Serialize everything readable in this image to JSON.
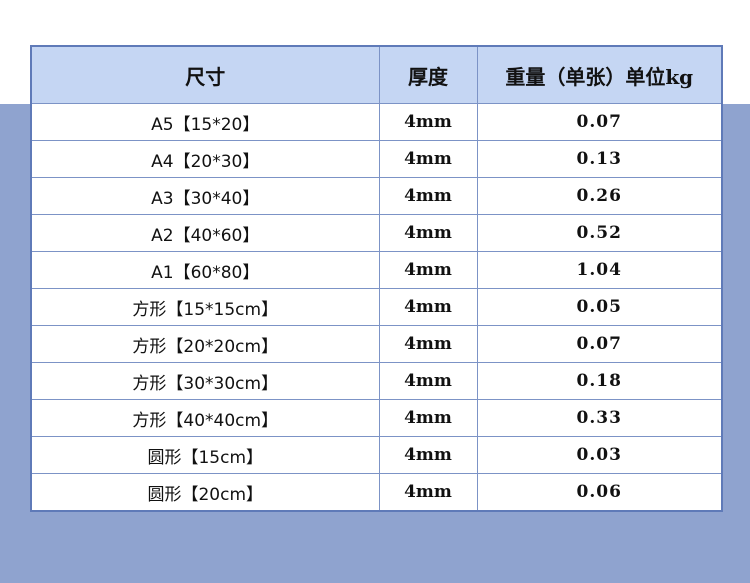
{
  "table": {
    "headers": [
      "尺寸",
      "厚度",
      "重量（单张）单位kg"
    ],
    "rows": [
      [
        "A5【15*20】",
        "4mm",
        "0.07"
      ],
      [
        "A4【20*30】",
        "4mm",
        "0.13"
      ],
      [
        "A3【30*40】",
        "4mm",
        "0.26"
      ],
      [
        "A2【40*60】",
        "4mm",
        "0.52"
      ],
      [
        "A1【60*80】",
        "4mm",
        "1.04"
      ],
      [
        "方形【15*15cm】",
        "4mm",
        "0.05"
      ],
      [
        "方形【20*20cm】",
        "4mm",
        "0.07"
      ],
      [
        "方形【30*30cm】",
        "4mm",
        "0.18"
      ],
      [
        "方形【40*40cm】",
        "4mm",
        "0.33"
      ],
      [
        "圆形【15cm】",
        "4mm",
        "0.03"
      ],
      [
        "圆形【20cm】",
        "4mm",
        "0.06"
      ]
    ]
  },
  "colors": {
    "header_bg": "#c5d6f3",
    "band_bg": "#8fa3cf",
    "border": "#7c93c6"
  }
}
